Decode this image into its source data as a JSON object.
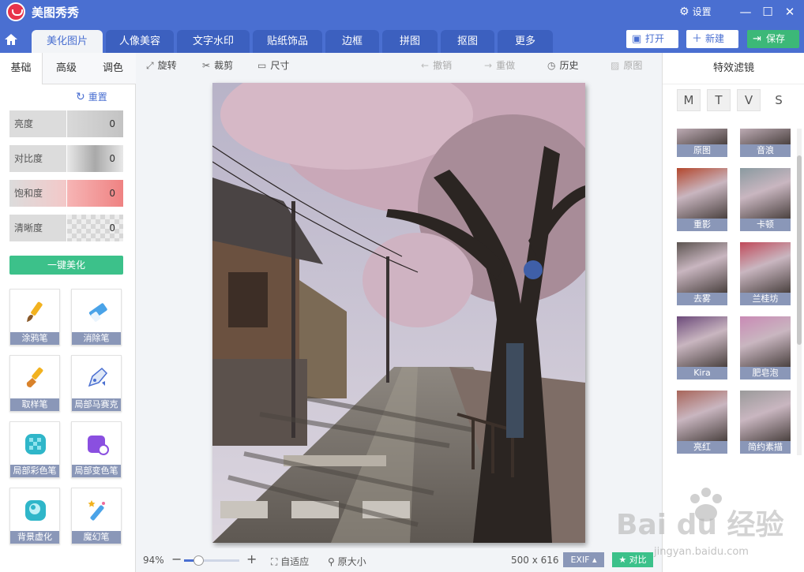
{
  "app": {
    "title": "美图秀秀",
    "settings_label": "设置"
  },
  "tabs": [
    {
      "label": "美化图片",
      "active": true
    },
    {
      "label": "人像美容"
    },
    {
      "label": "文字水印"
    },
    {
      "label": "贴纸饰品"
    },
    {
      "label": "边框"
    },
    {
      "label": "拼图"
    },
    {
      "label": "抠图"
    },
    {
      "label": "更多"
    }
  ],
  "actions": {
    "open": "打开",
    "new": "新建",
    "save": "保存"
  },
  "left_panel": {
    "subtabs": [
      {
        "label": "基础",
        "active": true
      },
      {
        "label": "高级"
      },
      {
        "label": "调色"
      }
    ],
    "reset_label": "重置",
    "adjustments": [
      {
        "label": "亮度",
        "value": "0",
        "track_color": "#cfcfcf"
      },
      {
        "label": "对比度",
        "value": "0",
        "track_color": "#bdbdbd"
      },
      {
        "label": "饱和度",
        "value": "0",
        "track_color": "#f08c8c"
      },
      {
        "label": "清晰度",
        "value": "0",
        "track_color": "#e0e0e0"
      }
    ],
    "one_key_label": "一键美化",
    "tools": [
      {
        "label": "涂鸦笔",
        "icon": "brush-icon"
      },
      {
        "label": "消除笔",
        "icon": "eraser-icon"
      },
      {
        "label": "取样笔",
        "icon": "sample-brush-icon"
      },
      {
        "label": "局部马赛克",
        "icon": "mosaic-pen-icon"
      },
      {
        "label": "局部彩色笔",
        "icon": "color-pen-icon"
      },
      {
        "label": "局部变色笔",
        "icon": "recolor-pen-icon"
      },
      {
        "label": "背景虚化",
        "icon": "blur-icon"
      },
      {
        "label": "魔幻笔",
        "icon": "magic-pen-icon"
      }
    ]
  },
  "toolbar": {
    "rotate": "旋转",
    "crop": "裁剪",
    "size": "尺寸",
    "undo": "撤销",
    "redo": "重做",
    "history": "历史",
    "original": "原图"
  },
  "bottom": {
    "zoom": "94%",
    "zoom_fraction": 0.26,
    "fit": "自适应",
    "actual_size": "原大小",
    "dimensions": "500 x 616",
    "exif": "EXIF ▴",
    "compare": "对比"
  },
  "right_panel": {
    "title": "特效滤镜",
    "categories": [
      "M",
      "T",
      "V",
      "S"
    ],
    "filters": [
      {
        "label": "原图",
        "tint": "#7a6a60"
      },
      {
        "label": "音浪",
        "tint": "#6b5a3f"
      },
      {
        "label": "重影",
        "tint": "#b3472d"
      },
      {
        "label": "卡顿",
        "tint": "#8a9aa0"
      },
      {
        "label": "去雾",
        "tint": "#5c5450"
      },
      {
        "label": "兰桂坊",
        "tint": "#c04a5a"
      },
      {
        "label": "Kira",
        "tint": "#6c4a7a"
      },
      {
        "label": "肥皂泡",
        "tint": "#c98ab5"
      },
      {
        "label": "亮红",
        "tint": "#a8655a"
      },
      {
        "label": "简约素描",
        "tint": "#9a9a9a"
      }
    ]
  },
  "watermark": {
    "logo": "Bai du 经验",
    "url": "jingyan.baidu.com"
  }
}
